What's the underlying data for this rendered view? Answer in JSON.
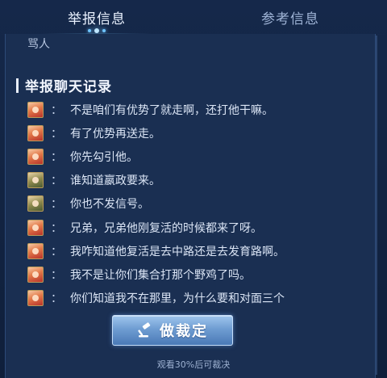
{
  "tabs": [
    {
      "label": "举报信息",
      "active": true
    },
    {
      "label": "参考信息",
      "active": false
    }
  ],
  "report": {
    "reason": "骂人",
    "chat_section_title": "举报聊天记录",
    "messages": [
      {
        "avatar": "hero-avatar-red",
        "text": "不是咱们有优势了就走啊，还打他干嘛。"
      },
      {
        "avatar": "hero-avatar-red",
        "text": "有了优势再送走。"
      },
      {
        "avatar": "hero-avatar-red",
        "text": "你先勾引他。"
      },
      {
        "avatar": "hero-avatar-green",
        "text": "谁知道嬴政要来。"
      },
      {
        "avatar": "hero-avatar-green",
        "text": "你也不发信号。"
      },
      {
        "avatar": "hero-avatar-red",
        "text": "兄弟，兄弟他刚复活的时候都来了呀。"
      },
      {
        "avatar": "hero-avatar-red",
        "text": "我咋知道他复活是去中路还是去发育路啊。"
      },
      {
        "avatar": "hero-avatar-red",
        "text": "我不是让你们集合打那个野鸡了吗。"
      },
      {
        "avatar": "hero-avatar-red",
        "text": "你们知道我不在那里，为什么要和对面三个"
      }
    ],
    "colon": "："
  },
  "actions": {
    "verdict_label": "做裁定",
    "verdict_icon": "gavel-icon",
    "hint": "观看30%后可裁决"
  },
  "colors": {
    "background": "#132544",
    "panel": "#1a2f52",
    "accent": "#6fc4ff",
    "button": "#6f9dd2"
  }
}
